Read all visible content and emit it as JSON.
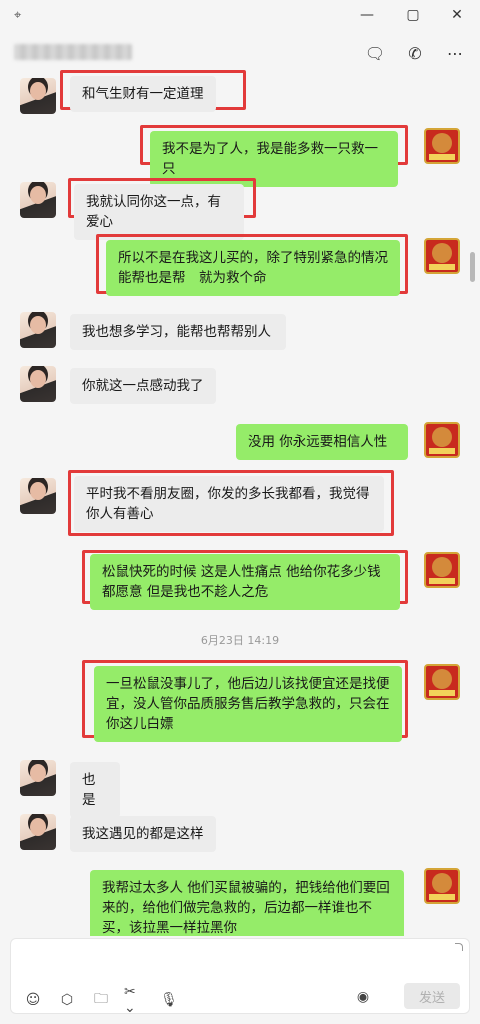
{
  "window": {
    "pin_icon": "pin-icon",
    "minimize_icon": "minimize-icon",
    "maximize_icon": "maximize-icon",
    "close_icon": "close-icon"
  },
  "header": {
    "chat_icon": "chat-bubble-icon",
    "call_icon": "phone-icon",
    "more_icon": "more-icon"
  },
  "messages": [
    {
      "side": "in",
      "text": "和气生财有一定道理",
      "highlight": true
    },
    {
      "side": "out",
      "text": "我不是为了人，我是能多救一只救一只",
      "highlight": true
    },
    {
      "side": "in",
      "text": "我就认同你这一点，有爱心",
      "highlight": true
    },
    {
      "side": "out",
      "text": "所以不是在我这儿买的，除了特别紧急的情况能帮也是帮　就为救个命",
      "highlight": true
    },
    {
      "side": "in",
      "text": "我也想多学习，能帮也帮帮别人",
      "highlight": false
    },
    {
      "side": "in",
      "text": "你就这一点感动我了",
      "highlight": false
    },
    {
      "side": "out",
      "text": "没用  你永远要相信人性",
      "highlight": false
    },
    {
      "side": "in",
      "text": "平时我不看朋友圈，你发的多长我都看，我觉得你人有善心",
      "highlight": true
    },
    {
      "side": "out",
      "text": "松鼠快死的时候  这是人性痛点  他给你花多少钱都愿意  但是我也不趁人之危",
      "highlight": true
    },
    {
      "side": "time",
      "text": "6月23日 14:19"
    },
    {
      "side": "out",
      "text": "一旦松鼠没事儿了，他后边儿该找便宜还是找便宜，没人管你品质服务售后教学急救的，只会在你这儿白嫖",
      "highlight": true
    },
    {
      "side": "in",
      "text": "也是",
      "highlight": false
    },
    {
      "side": "in",
      "text": "我这遇见的都是这样",
      "highlight": false
    },
    {
      "side": "out",
      "text": "我帮过太多人 他们买鼠被骗的，把钱给他们要回来的，给他们做完急救的，后边都一样谁也不买，该拉黑一样拉黑你",
      "highlight": false
    }
  ],
  "toolbar": {
    "emoji_icon": "emoji-icon",
    "box_icon": "favorites-box-icon",
    "folder_icon": "folder-icon",
    "scissors_icon": "scissors-icon",
    "mic_icon": "microphone-icon",
    "voice_call_icon": "voice-call-icon",
    "send_label": "发送"
  }
}
